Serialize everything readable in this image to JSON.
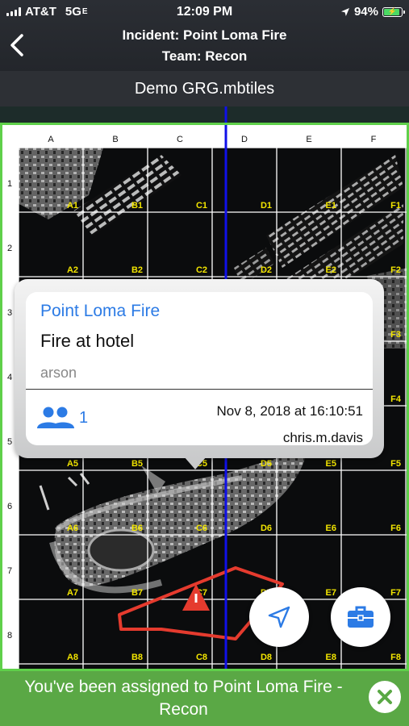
{
  "status_bar": {
    "carrier": "AT&T",
    "network": "5G",
    "network_suffix": "E",
    "time": "12:09 PM",
    "battery": "94%"
  },
  "header": {
    "incident_title": "Incident: Point Loma Fire",
    "team_title": "Team: Recon"
  },
  "subbar": {
    "layer_name": "Demo GRG.mbtiles"
  },
  "grid": {
    "columns": [
      "A",
      "B",
      "C",
      "D",
      "E",
      "F"
    ],
    "rows": [
      "1",
      "2",
      "3",
      "4",
      "5",
      "6",
      "7",
      "8"
    ],
    "visible_cell_labels": [
      "A1",
      "B1",
      "C1",
      "D1",
      "E1",
      "F1",
      "A2",
      "B2",
      "C2",
      "D2",
      "E2",
      "F2",
      "F3",
      "F4",
      "A5",
      "B5",
      "C5",
      "D5",
      "E5",
      "F5",
      "A6",
      "B6",
      "C6",
      "D6",
      "E6",
      "F6",
      "A7",
      "B7",
      "C7",
      "D7",
      "E7",
      "F7",
      "A8",
      "B8",
      "C8",
      "D8",
      "E8",
      "F8"
    ]
  },
  "popup": {
    "title": "Point Loma Fire",
    "description": "Fire at hotel",
    "category": "arson",
    "people_count": "1",
    "date": "Nov 8, 2018 at 16:10:51",
    "user": "chris.m.davis"
  },
  "banner": {
    "message": "You've been assigned to Point Loma Fire - Recon"
  },
  "colors": {
    "accent_blue": "#2c7be5",
    "grid_border": "#5fd04a",
    "banner_green": "#5aa845",
    "incident_red": "#e53b2e",
    "vertical_line": "#1010e8",
    "cell_label": "#f2e500"
  },
  "icons": {
    "back": "chevron-left-icon",
    "people": "group-icon",
    "navigate": "navigation-arrow-icon",
    "briefcase": "briefcase-icon",
    "close": "close-circle-icon",
    "location": "location-arrow-icon",
    "incident": "warning-triangle-icon"
  }
}
